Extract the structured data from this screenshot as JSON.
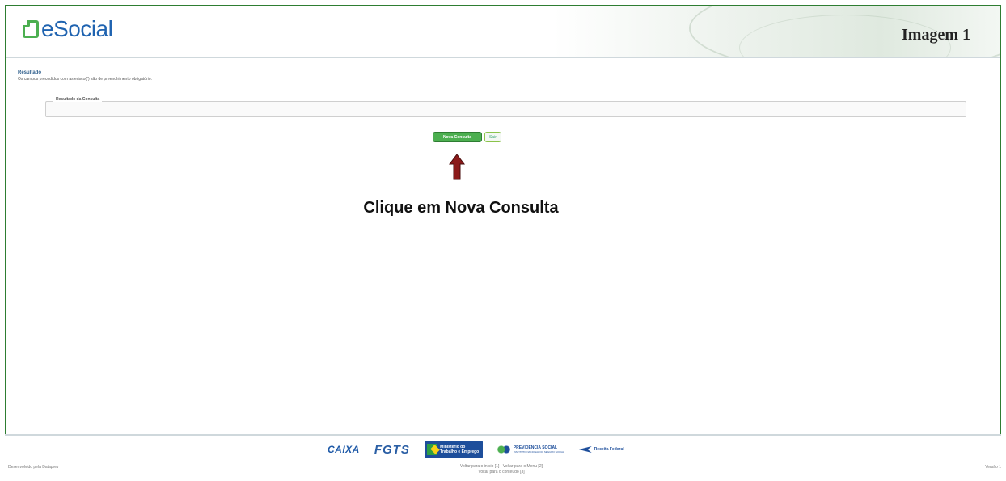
{
  "header": {
    "logo_text": "eSocial",
    "image_label": "Imagem 1"
  },
  "section": {
    "title": "Resultado",
    "note": "Os campos precedidos com asterisco(*) são de preenchimento obrigatório.",
    "fieldset_legend": "Resultado da Consulta"
  },
  "actions": {
    "nova_consulta": "Nova Consulta",
    "sair": "Sair"
  },
  "annotation": {
    "instruction": "Clique em Nova Consulta",
    "arrow_color": "#8b1a1a"
  },
  "partners": {
    "caixa": "CAIXA",
    "fgts": "FGTS",
    "mte": "Ministério do Trabalho e Emprego",
    "previdencia": "PREVIDÊNCIA SOCIAL",
    "previdencia_sub": "INSTITUTO NACIONAL DO SEGURO SOCIAL",
    "receita": "Receita Federal"
  },
  "footer": {
    "left": "Desenvolvido pela Dataprev",
    "center_line1": "Voltar para o início [1] · Voltar para o Menu [2]",
    "center_line2": "Voltar para o conteúdo [3]",
    "right": "Versão 1"
  },
  "colors": {
    "brand_green": "#4caf50",
    "brand_blue": "#1f63b0",
    "frame_green": "#2e7d32"
  }
}
